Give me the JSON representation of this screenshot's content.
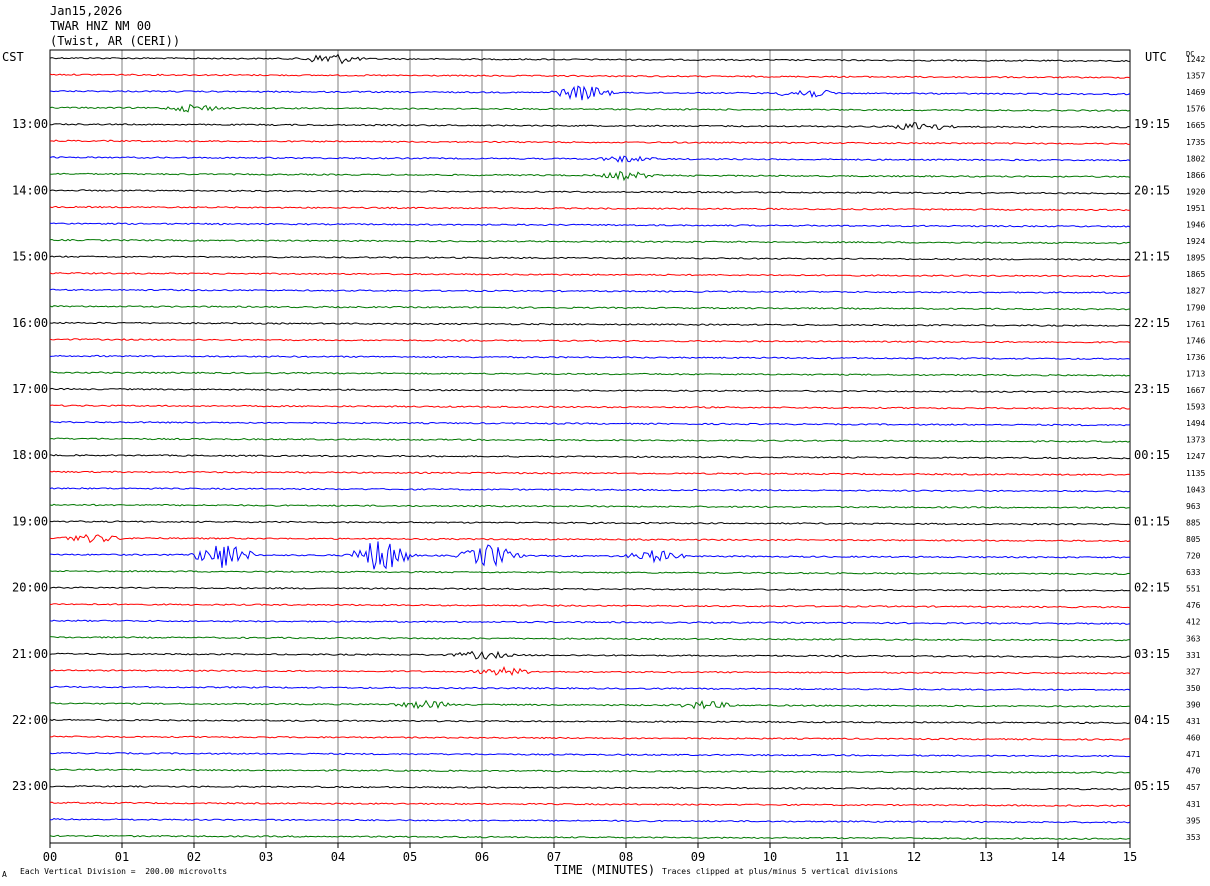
{
  "header": {
    "date": "Jan15,2026",
    "station": "TWAR HNZ NM 00",
    "location": "(Twist, AR (CERI))"
  },
  "axes": {
    "left_title": "CST",
    "right_title": "UTC",
    "dc_title": "DC",
    "x_label": "TIME (MINUTES)",
    "x_ticks": [
      "00",
      "01",
      "02",
      "03",
      "04",
      "05",
      "06",
      "07",
      "08",
      "09",
      "10",
      "11",
      "12",
      "13",
      "14",
      "15"
    ]
  },
  "footer": {
    "scale": "Each Vertical Division =  200.00 microvolts",
    "clip": "Traces clipped at plus/minus 5 vertical divisions",
    "corner": "A"
  },
  "colors": {
    "trace_cycle": [
      "#000000",
      "#ff0000",
      "#0000ff",
      "#007700"
    ],
    "grid": "#7f7f7f"
  },
  "chart_data": {
    "type": "line",
    "title": "",
    "xlabel": "TIME (MINUTES)",
    "ylabel": "",
    "xlim": [
      0,
      15
    ],
    "rows": 48,
    "grid": true,
    "cst_labels": [
      "13:00",
      "14:00",
      "15:00",
      "16:00",
      "17:00",
      "18:00",
      "19:00",
      "20:00",
      "21:00",
      "22:00",
      "23:00"
    ],
    "utc_labels": [
      "19:15",
      "20:15",
      "21:15",
      "22:15",
      "23:15",
      "00:15",
      "01:15",
      "02:15",
      "03:15",
      "04:15",
      "05:15"
    ],
    "dc_offsets": [
      1242,
      1357,
      1469,
      1576,
      1665,
      1735,
      1802,
      1866,
      1920,
      1951,
      1946,
      1924,
      1895,
      1865,
      1827,
      1790,
      1761,
      1746,
      1736,
      1713,
      1667,
      1593,
      1494,
      1373,
      1247,
      1135,
      1043,
      963,
      885,
      805,
      720,
      633,
      551,
      476,
      412,
      363,
      331,
      327,
      350,
      390,
      431,
      460,
      471,
      470,
      457,
      431,
      395,
      353
    ],
    "events": [
      {
        "row": 0,
        "minute": 3.9,
        "amp": 6
      },
      {
        "row": 2,
        "minute": 7.4,
        "amp": 8
      },
      {
        "row": 2,
        "minute": 10.5,
        "amp": 5
      },
      {
        "row": 3,
        "minute": 2.0,
        "amp": 4
      },
      {
        "row": 4,
        "minute": 12.1,
        "amp": 5
      },
      {
        "row": 6,
        "minute": 8.0,
        "amp": 3
      },
      {
        "row": 7,
        "minute": 8.0,
        "amp": 4
      },
      {
        "row": 30,
        "minute": 2.4,
        "amp": 14
      },
      {
        "row": 30,
        "minute": 4.6,
        "amp": 18
      },
      {
        "row": 30,
        "minute": 6.1,
        "amp": 12
      },
      {
        "row": 30,
        "minute": 8.4,
        "amp": 6
      },
      {
        "row": 29,
        "minute": 0.6,
        "amp": 4
      },
      {
        "row": 36,
        "minute": 6.0,
        "amp": 4
      },
      {
        "row": 37,
        "minute": 6.3,
        "amp": 4
      },
      {
        "row": 39,
        "minute": 5.2,
        "amp": 4
      },
      {
        "row": 39,
        "minute": 9.1,
        "amp": 4
      }
    ]
  }
}
